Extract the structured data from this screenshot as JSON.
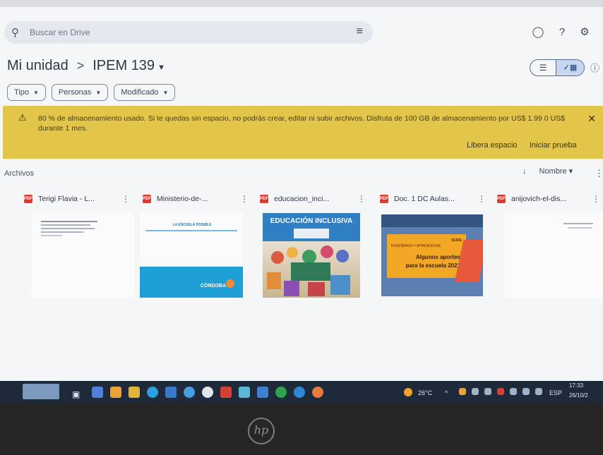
{
  "search": {
    "placeholder": "Buscar en Drive",
    "icon": "search-icon",
    "filter_icon": "tune-icon"
  },
  "header_icons": [
    "offline-status-icon",
    "help-icon",
    "settings-icon"
  ],
  "breadcrumb": {
    "root": "Mi unidad",
    "separator": ">",
    "current": "IPEM 139"
  },
  "view_toggle": {
    "list_icon": "list-view-icon",
    "grid_icon": "grid-view-icon",
    "selected": "grid"
  },
  "filters": [
    {
      "label": "Tipo"
    },
    {
      "label": "Personas"
    },
    {
      "label": "Modificado"
    }
  ],
  "banner": {
    "text": "80 % de almacenamiento usado. Si te quedas sin espacio, no podrás crear, editar ni subir archivos. Disfruta de 100 GB de almacenamiento por US$ 1.99 0 US$ durante 1 mes.",
    "free_space": "Libera espacio",
    "start_trial": "Iniciar prueba",
    "color": "#e3c54a"
  },
  "files_section": {
    "title": "Archivos",
    "sort_label": "Nombre"
  },
  "files": [
    {
      "name": "Terigi Flavia - L..."
    },
    {
      "name": "Ministerio-de-..."
    },
    {
      "name": "educacion_inci..."
    },
    {
      "name": "Doc. 1 DC Aulas..."
    },
    {
      "name": "anijovich-el-dis..."
    }
  ],
  "thumbnails": {
    "t3_title": "EDUCACIÓN INCLUSIVA",
    "t2_title": "LA ESCUELA POSIBLE",
    "t2_brand": "CÓRDOBA",
    "t4_line1": "SERIE",
    "t4_line2": "ENSEÑANZA Y APRENDIZAJE",
    "t4_line3": "Algunos aportes",
    "t4_line4": "para la escuela 2021"
  },
  "taskbar": {
    "temperature": "26°C",
    "language": "ESP",
    "time": "17:33",
    "date": "26/10/2"
  },
  "laptop": {
    "logo": "hp"
  }
}
